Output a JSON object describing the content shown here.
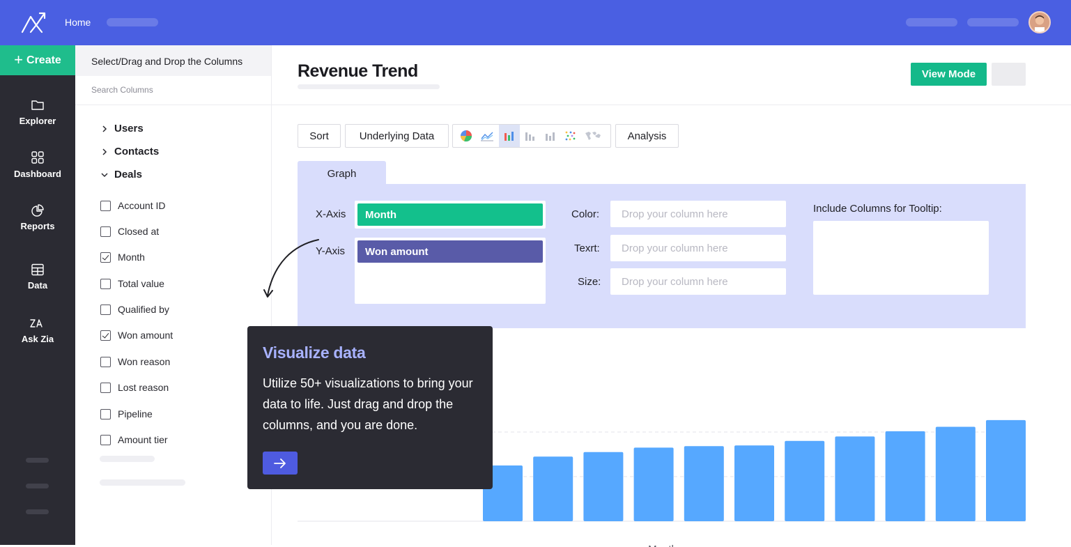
{
  "colors": {
    "topbar": "#4a5fe2",
    "accent_green": "#14b98a",
    "rail": "#2b2b33",
    "bar": "#56a8ff",
    "graph_panel": "#d9ddfc",
    "popup_title": "#a8b2ff"
  },
  "topbar": {
    "home_label": "Home"
  },
  "rail": {
    "create_label": "Create",
    "items": [
      {
        "label": "Explorer",
        "icon": "folder-icon"
      },
      {
        "label": "Dashboard",
        "icon": "grid-icon"
      },
      {
        "label": "Reports",
        "icon": "pie-chart-icon"
      },
      {
        "label": "Data",
        "icon": "table-icon"
      },
      {
        "label": "Ask Zia",
        "icon": "zia-icon"
      }
    ]
  },
  "columns_panel": {
    "header": "Select/Drag and Drop the Columns",
    "search_placeholder": "Search Columns",
    "groups": [
      {
        "label": "Users",
        "expanded": false
      },
      {
        "label": "Contacts",
        "expanded": false
      },
      {
        "label": "Deals",
        "expanded": true
      }
    ],
    "items": [
      {
        "label": "Account ID",
        "checked": false
      },
      {
        "label": "Closed at",
        "checked": false
      },
      {
        "label": "Month",
        "checked": true
      },
      {
        "label": "Total value",
        "checked": false
      },
      {
        "label": "Qualified by",
        "checked": false
      },
      {
        "label": "Won amount",
        "checked": true
      },
      {
        "label": "Won reason",
        "checked": false
      },
      {
        "label": "Lost reason",
        "checked": false
      },
      {
        "label": "Pipeline",
        "checked": false
      },
      {
        "label": "Amount tier",
        "checked": false
      }
    ]
  },
  "main": {
    "title": "Revenue Trend",
    "view_mode_label": "View Mode",
    "toolbar": {
      "sort_label": "Sort",
      "underlying_label": "Underlying Data",
      "analysis_label": "Analysis",
      "chart_types": [
        "pie-chart-icon",
        "line-chart-icon",
        "bar-chart-icon",
        "column-chart-icon",
        "stacked-chart-icon",
        "scatter-chart-icon",
        "map-chart-icon"
      ],
      "active_chart_type": "bar-chart-icon"
    },
    "tab_label": "Graph",
    "config": {
      "x_axis_label": "X-Axis",
      "y_axis_label": "Y-Axis",
      "x_axis_value": "Month",
      "y_axis_value": "Won amount",
      "color_label": "Color:",
      "text_label": "Texrt:",
      "size_label": "Size:",
      "drop_placeholder": "Drop your column here",
      "tooltip_label": "Include Columns for Tooltip:"
    }
  },
  "chart_data": {
    "type": "bar",
    "xlabel": "Month",
    "ylabel": "",
    "values": [
      75,
      87,
      93,
      99,
      101,
      102,
      108,
      114,
      121,
      127,
      136
    ],
    "ylim": [
      0,
      150
    ],
    "grid": true
  },
  "popup": {
    "title": "Visualize data",
    "text": "Utilize 50+ visualizations to bring your data to life. Just drag and drop the columns, and you are done.",
    "button_icon": "arrow-right-icon"
  }
}
